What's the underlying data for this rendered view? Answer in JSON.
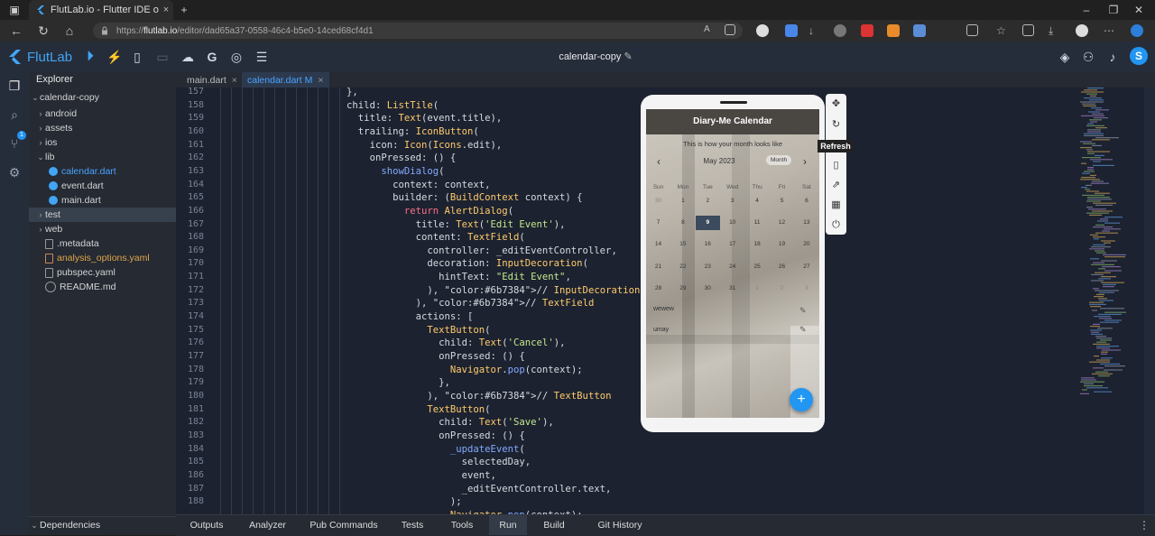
{
  "browser": {
    "tab_title": "FlutLab.io - Flutter IDE online",
    "url_prefix": "https://",
    "url_host": "flutlab.io",
    "url_path": "/editor/dad65a37-0558-46c4-b5e0-14ced68cf4d1",
    "new_tab": "+",
    "tab_close": "×",
    "win_min": "–",
    "win_max": "❐",
    "win_close": "✕"
  },
  "app": {
    "logo_text": "FlutLab",
    "project_title": "calendar-copy",
    "avatar_letter": "S",
    "accent_color": "#2196f3"
  },
  "activity": {
    "scm_badge": "1"
  },
  "explorer": {
    "title": "Explorer",
    "tree": [
      {
        "label": "calendar-copy",
        "chev": "⌄"
      },
      {
        "label": "android",
        "chev": "›"
      },
      {
        "label": "assets",
        "chev": "›"
      },
      {
        "label": "ios",
        "chev": "›"
      },
      {
        "label": "lib",
        "chev": "⌄"
      },
      {
        "label": "calendar.dart",
        "mod": "M"
      },
      {
        "label": "event.dart"
      },
      {
        "label": "main.dart"
      },
      {
        "label": "test",
        "chev": "›"
      },
      {
        "label": "web",
        "chev": "›"
      },
      {
        "label": ".metadata"
      },
      {
        "label": "analysis_options.yaml"
      },
      {
        "label": "pubspec.yaml"
      },
      {
        "label": "README.md"
      }
    ],
    "dependencies": "Dependencies",
    "dep_chev": "⌄"
  },
  "editor": {
    "tabs": [
      {
        "label": "main.dart",
        "close": "×"
      },
      {
        "label": "calendar.dart M",
        "close": "×"
      }
    ],
    "line_numbers": [
      "157",
      "158",
      "159",
      "160",
      "161",
      "162",
      "163",
      "164",
      "165",
      "166",
      "167",
      "168",
      "169",
      "170",
      "171",
      "172",
      "173",
      "174",
      "175",
      "176",
      "177",
      "178",
      "179",
      "180",
      "181",
      "182",
      "183",
      "184",
      "185",
      "186",
      "187",
      "188"
    ],
    "lines": [
      "  },",
      "  child: ListTile(",
      "    title: Text(event.title),",
      "    trailing: IconButton(",
      "      icon: Icon(Icons.edit),",
      "      onPressed: () {",
      "        showDialog(",
      "          context: context,",
      "          builder: (BuildContext context) {",
      "            return AlertDialog(",
      "              title: Text('Edit Event'),",
      "              content: TextField(",
      "                controller: _editEventController,",
      "                decoration: InputDecoration(",
      "                  hintText: \"Edit Event\",",
      "                ), // InputDecoration",
      "              ), // TextField",
      "              actions: [",
      "                TextButton(",
      "                  child: Text('Cancel'),",
      "                  onPressed: () {",
      "                    Navigator.pop(context);",
      "                  },",
      "                ), // TextButton",
      "                TextButton(",
      "                  child: Text('Save'),",
      "                  onPressed: () {",
      "                    _updateEvent(",
      "                      selectedDay,",
      "                      event,",
      "                      _editEventController.text,",
      "                    );",
      "                    Navigator.pop(context);"
    ]
  },
  "preview": {
    "app_title": "Diary-Me Calendar",
    "subtitle": "This is how your month looks like",
    "month_label": "May 2023",
    "format_button": "Month",
    "prev_icon": "‹",
    "next_icon": "›",
    "weekdays": [
      "Sun",
      "Mon",
      "Tue",
      "Wed",
      "Thu",
      "Fri",
      "Sat"
    ],
    "weeks": [
      [
        "30",
        "1",
        "2",
        "3",
        "4",
        "5",
        "6"
      ],
      [
        "7",
        "8",
        "9",
        "10",
        "11",
        "12",
        "13"
      ],
      [
        "14",
        "15",
        "16",
        "17",
        "18",
        "19",
        "20"
      ],
      [
        "21",
        "22",
        "23",
        "24",
        "25",
        "26",
        "27"
      ],
      [
        "28",
        "29",
        "30",
        "31",
        "1",
        "2",
        "3"
      ]
    ],
    "selected_day": "9",
    "events": [
      "wewew",
      "umay"
    ],
    "fab": "+",
    "tooltip": "Refresh"
  },
  "bottom": {
    "tabs": [
      "Outputs",
      "Analyzer",
      "Pub Commands",
      "Tests",
      "Tools",
      "Run",
      "Build",
      "Git History"
    ],
    "active": "Run",
    "more": "⋮"
  }
}
